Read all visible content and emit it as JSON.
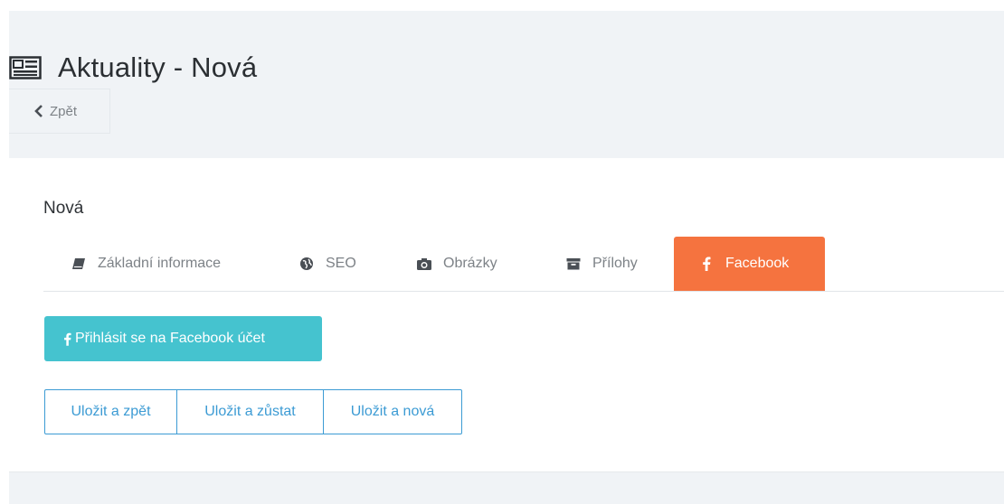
{
  "header": {
    "title": "Aktuality - Nová",
    "title_icon": "newspaper-icon",
    "back_icon": "chevron-left-icon",
    "back_label": "Zpět"
  },
  "panel": {
    "title": "Nová"
  },
  "tabs": [
    {
      "label": "Základní informace",
      "icon": "book-icon",
      "active": false
    },
    {
      "label": "SEO",
      "icon": "globe-icon",
      "active": false
    },
    {
      "label": "Obrázky",
      "icon": "camera-icon",
      "active": false
    },
    {
      "label": "Přílohy",
      "icon": "archive-icon",
      "active": false
    },
    {
      "label": "Facebook",
      "icon": "facebook-icon",
      "active": true
    }
  ],
  "facebook": {
    "login_label": "Přihlásit se na Facebook účet",
    "login_icon": "facebook-icon"
  },
  "actions": [
    {
      "label": "Uložit a zpět"
    },
    {
      "label": "Uložit a zůstat"
    },
    {
      "label": "Uložit a nová"
    }
  ],
  "colors": {
    "header_bg": "#f0f3f6",
    "active_tab": "#f5733f",
    "facebook_button": "#45c3cf",
    "save_button_border": "#3c9bd4"
  }
}
